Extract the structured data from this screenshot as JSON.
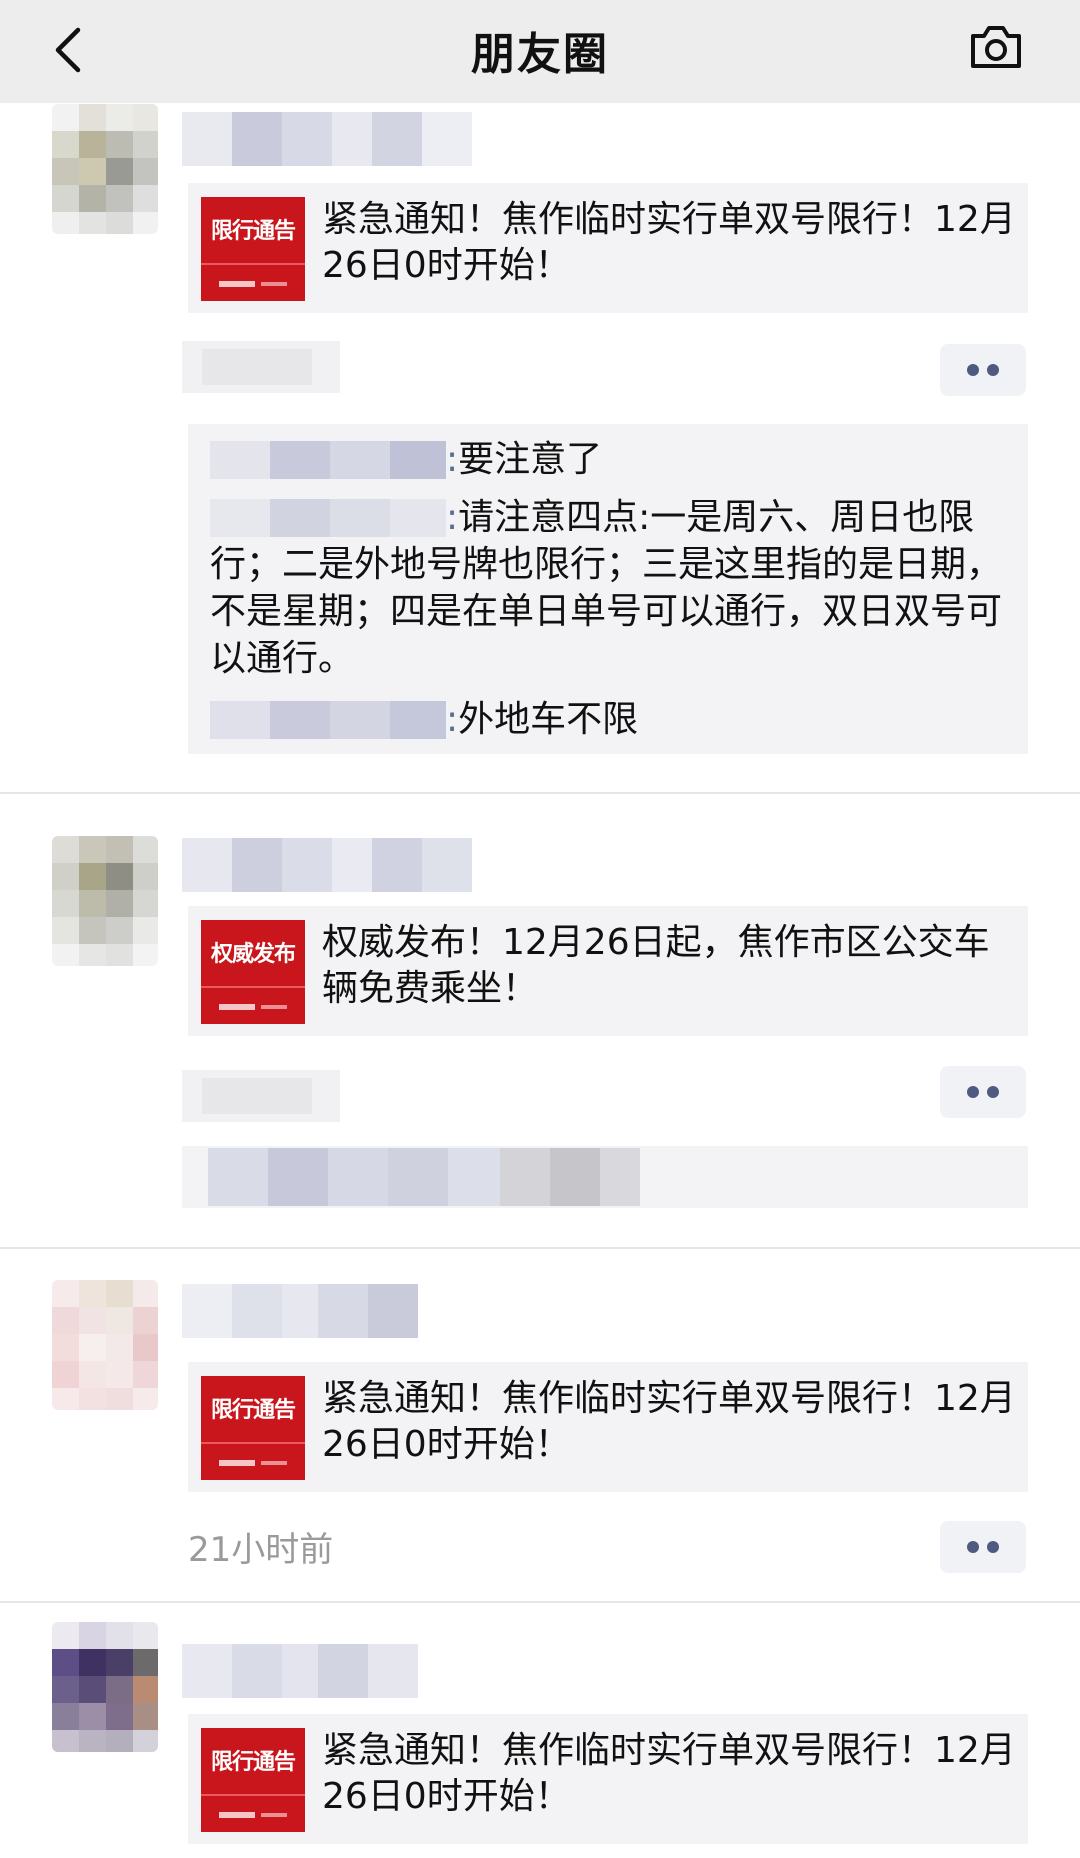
{
  "nav": {
    "title": "朋友圈",
    "back_icon": "chevron-left-icon",
    "camera_icon": "camera-icon",
    "background": "#ededed"
  },
  "posts": [
    {
      "link": {
        "thumb_tag": "限行通告",
        "text": "紧急通知！焦作临时实行单双号限行！12月26日0时开始！"
      },
      "comments": [
        {
          "sep": ":",
          "text": "要注意了"
        },
        {
          "sep": ":",
          "text": "请注意四点:一是周六、周日也限行；二是外地号牌也限行；三是这里指的是日期，不是星期；四是在单日单号可以通行，双日双号可以通行。"
        },
        {
          "sep": ":",
          "text": "外地车不限"
        }
      ]
    },
    {
      "link": {
        "thumb_tag": "权威发布",
        "text": "权威发布！12月26日起，焦作市区公交车辆免费乘坐！"
      }
    },
    {
      "link": {
        "thumb_tag": "限行通告",
        "text": "紧急通知！焦作临时实行单双号限行！12月26日0时开始！"
      },
      "time": "21小时前"
    },
    {
      "link": {
        "thumb_tag": "限行通告",
        "text": "紧急通知！焦作临时实行单双号限行！12月26日0时开始！"
      }
    }
  ],
  "colors": {
    "accent_red": "#c9161c",
    "link_blue": "#576b95",
    "card_bg": "#f3f3f5",
    "time_gray": "#9a9a9a"
  }
}
